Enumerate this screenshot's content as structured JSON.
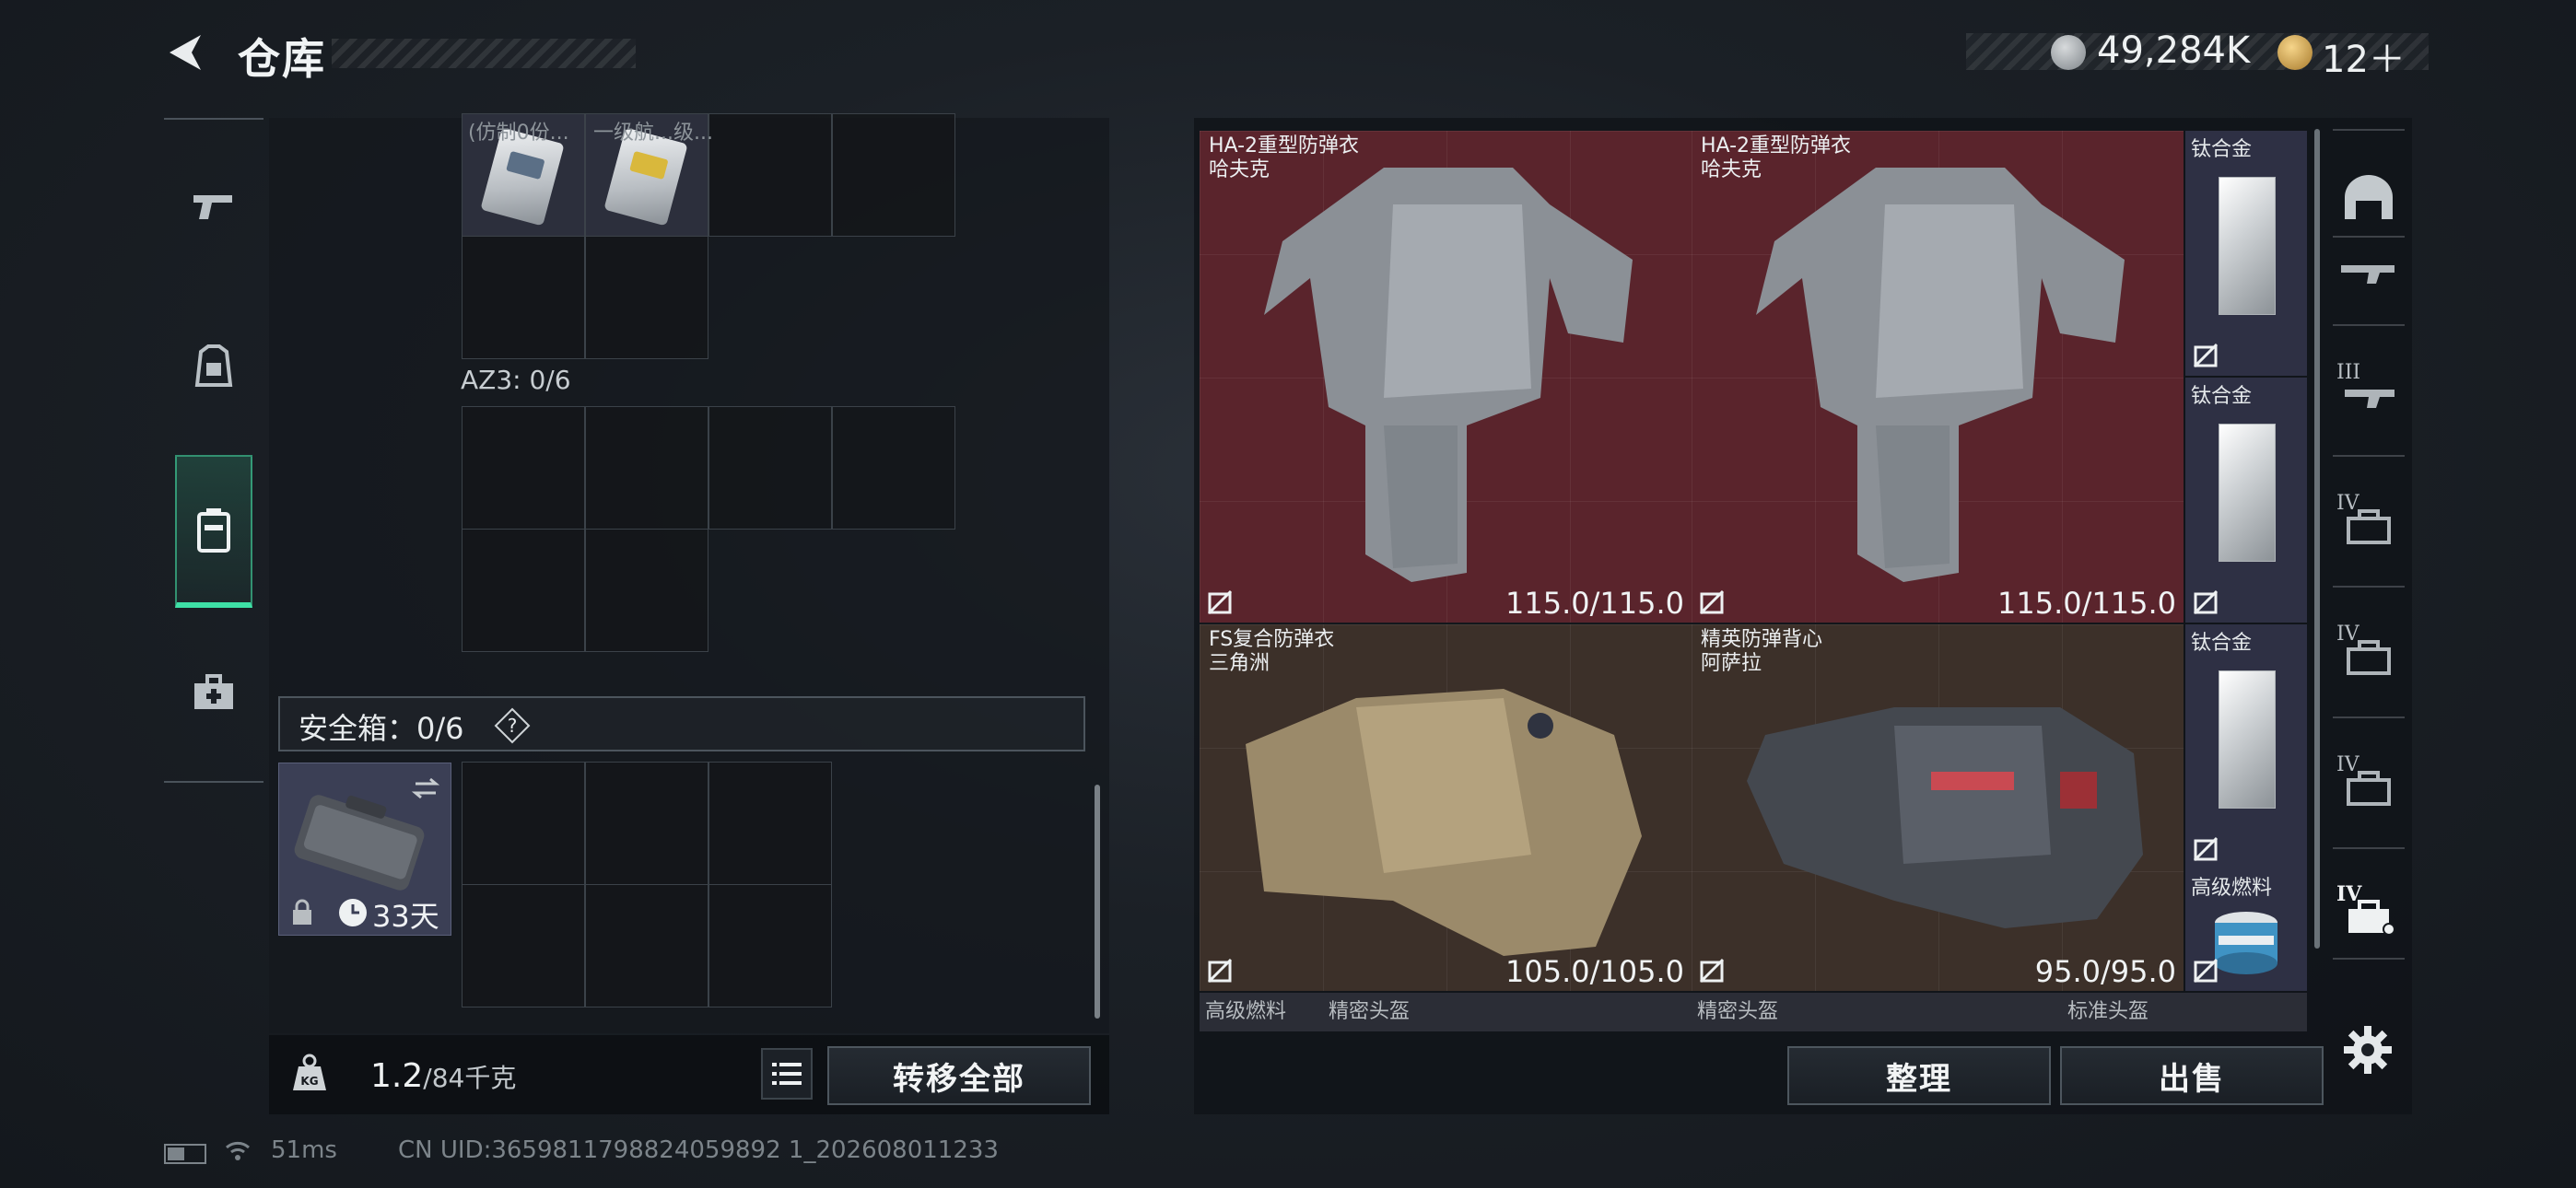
{
  "header": {
    "title": "仓库",
    "currency": [
      {
        "icon": "silver-coin-icon",
        "value": "49,284K"
      },
      {
        "icon": "gold-coin-icon",
        "value": "12＋"
      }
    ]
  },
  "left_nav": {
    "items": [
      {
        "icon": "pistol-icon",
        "active": false
      },
      {
        "icon": "helmet-armor-icon",
        "active": false
      },
      {
        "icon": "backpack-icon",
        "active": true
      },
      {
        "icon": "medkit-icon",
        "active": false
      }
    ]
  },
  "storage": {
    "cut_labels": [
      "(仿制0份...",
      "一级航...级..."
    ],
    "az3_label": "AZ3: 0/6",
    "safebox_label": "安全箱：0/6",
    "safebox_help": "?",
    "case_timer": "33天",
    "weight_value": "1.2",
    "weight_capacity": "/84千克",
    "transfer_all": "转移全部"
  },
  "inventory": {
    "armors": [
      {
        "name": "HA-2重型防弹衣",
        "brand": "哈夫克",
        "durability": "115.0/115.0",
        "rarity_color": "#5a242c"
      },
      {
        "name": "HA-2重型防弹衣",
        "brand": "哈夫克",
        "durability": "115.0/115.0",
        "rarity_color": "#5a242c"
      },
      {
        "name": "FS复合防弹衣",
        "brand": "三角洲",
        "durability": "105.0/105.0",
        "rarity_color": "#3c3029"
      },
      {
        "name": "精英防弹背心",
        "brand": "阿萨拉",
        "durability": "95.0/95.0",
        "rarity_color": "#3c3029"
      }
    ],
    "side_items": [
      "钛合金",
      "钛合金",
      "钛合金",
      "高级燃料"
    ],
    "bottom_row": [
      "高级燃料",
      "精密头盔",
      "精密头盔",
      "标准头盔"
    ],
    "organize": "整理",
    "sell": "出售"
  },
  "right_nav": {
    "items": [
      {
        "icon": "helmet-icon",
        "tier": ""
      },
      {
        "icon": "rifle-icon",
        "tier": ""
      },
      {
        "icon": "rifle-tier-icon",
        "tier": "III"
      },
      {
        "icon": "case-tier-icon",
        "tier": "IV"
      },
      {
        "icon": "case-tier-icon",
        "tier": "IV"
      },
      {
        "icon": "case-tier-icon",
        "tier": "IV"
      },
      {
        "icon": "case-tier-active-icon",
        "tier": "IV"
      }
    ]
  },
  "status": {
    "ping": "51ms",
    "uid": "CN UID:3659811798824059892 1_202608011233"
  }
}
